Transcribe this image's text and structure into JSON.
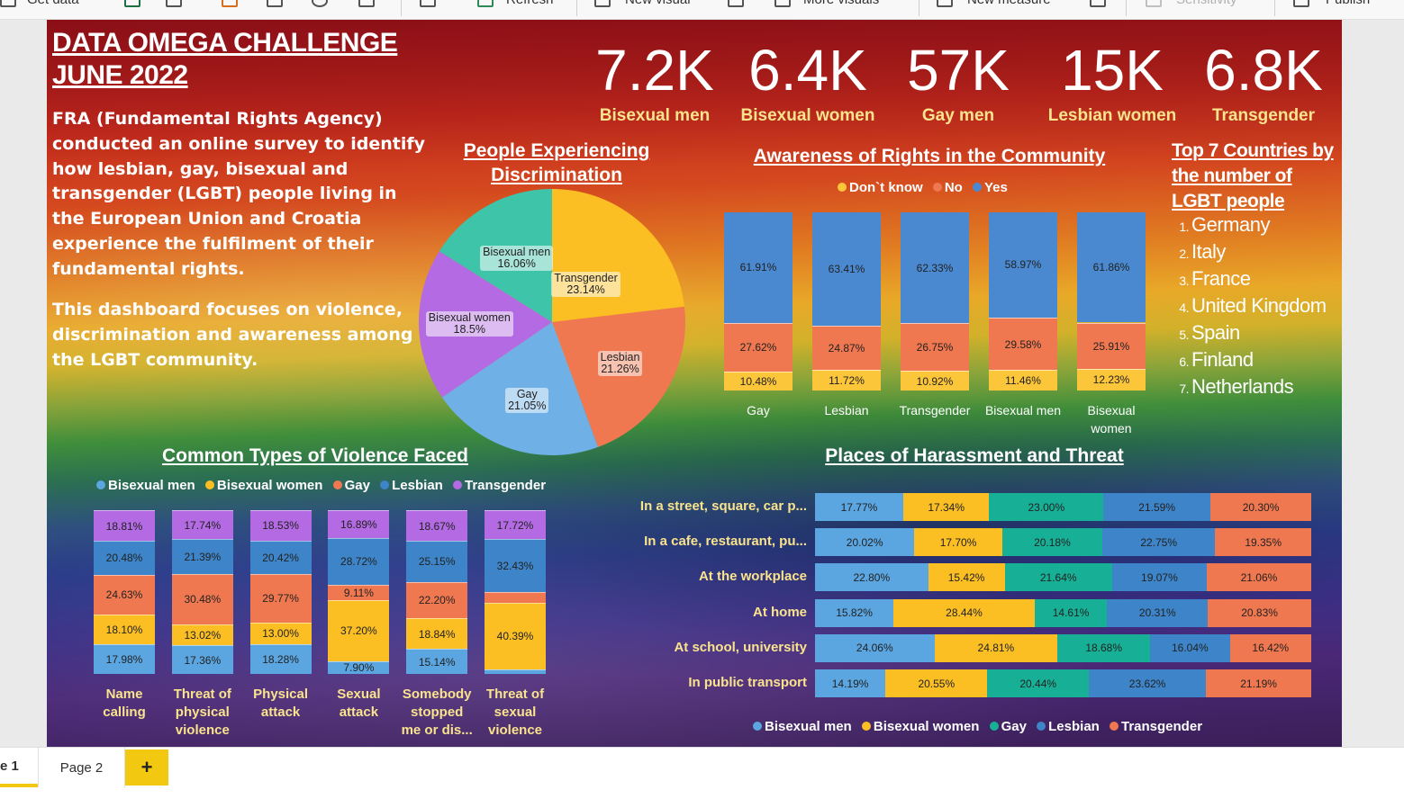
{
  "ribbon": {
    "items": [
      "Get data",
      "Refresh",
      "New visual",
      "More visuals",
      "New measure",
      "Sensitivity",
      "Publish"
    ]
  },
  "report": {
    "title_line1": "DATA OMEGA CHALLENGE",
    "title_line2": "JUNE 2022",
    "intro": "FRA (Fundamental Rights Agency) conducted an online survey to identify how lesbian, gay, bisexual and transgender (LGBT) people living in the European Union and Croatia experience the fulfilment of their fundamental rights.",
    "focus": "This dashboard focuses on violence, discrimination and awareness among the LGBT community."
  },
  "kpis": [
    {
      "value": "7.2K",
      "label": "Bisexual men"
    },
    {
      "value": "6.4K",
      "label": "Bisexual women"
    },
    {
      "value": "57K",
      "label": "Gay men"
    },
    {
      "value": "15K",
      "label": "Lesbian women"
    },
    {
      "value": "6.8K",
      "label": "Transgender"
    }
  ],
  "colors": {
    "bisexual_men": "#5ba6e0",
    "bisexual_women": "#fbbf24",
    "gay": "#f07850",
    "lesbian": "#3d85c8",
    "transgender": "#b36ae2",
    "gay_teal": "#17b096",
    "pie_teal": "#3ec4a8",
    "pie_gay": "#6fb0e6",
    "awareness_yes": "#4a89cf",
    "awareness_no": "#f07850",
    "awareness_dontknow": "#fcc63a"
  },
  "pie": {
    "title": "People Experiencing Discrimination",
    "chart_data": {
      "type": "pie",
      "slices": [
        {
          "name": "Transgender",
          "value": 23.14,
          "label": "23.14%"
        },
        {
          "name": "Lesbian",
          "value": 21.26,
          "label": "21.26%"
        },
        {
          "name": "Gay",
          "value": 21.05,
          "label": "21.05%"
        },
        {
          "name": "Bisexual women",
          "value": 18.5,
          "label": "18.5%"
        },
        {
          "name": "Bisexual men",
          "value": 16.06,
          "label": "16.06%"
        }
      ]
    }
  },
  "awareness": {
    "title": "Awareness of Rights in the Community",
    "legend": [
      "Don`t know",
      "No",
      "Yes"
    ],
    "chart_data": {
      "type": "bar",
      "stacked": true,
      "categories": [
        "Gay",
        "Lesbian",
        "Transgender",
        "Bisexual men",
        "Bisexual women"
      ],
      "series": [
        {
          "name": "Don`t know",
          "values": [
            10.48,
            11.72,
            10.92,
            11.46,
            12.23
          ]
        },
        {
          "name": "No",
          "values": [
            27.62,
            24.87,
            26.75,
            29.58,
            25.91
          ]
        },
        {
          "name": "Yes",
          "values": [
            61.91,
            63.41,
            62.33,
            58.97,
            61.86
          ]
        }
      ]
    }
  },
  "countries": {
    "title": "Top 7 Countries by the number of LGBT people",
    "items": [
      "Germany",
      "Italy",
      "France",
      "United Kingdom",
      "Spain",
      "Finland",
      "Netherlands"
    ]
  },
  "violence": {
    "title": "Common Types of Violence Faced",
    "legend": [
      "Bisexual men",
      "Bisexual women",
      "Gay",
      "Lesbian",
      "Transgender"
    ],
    "chart_data": {
      "type": "bar",
      "stacked": true,
      "categories": [
        "Name calling",
        "Threat of physical violence",
        "Physical attack",
        "Sexual attack",
        "Somebody stopped me or dis...",
        "Threat of sexual violence"
      ],
      "series": [
        {
          "name": "Bisexual men",
          "values": [
            17.98,
            17.36,
            18.28,
            7.9,
            15.14,
            3.03
          ]
        },
        {
          "name": "Bisexual women",
          "values": [
            18.1,
            13.02,
            13.0,
            37.2,
            18.84,
            40.39
          ]
        },
        {
          "name": "Gay",
          "values": [
            24.63,
            30.48,
            29.77,
            9.11,
            22.2,
            6.44
          ]
        },
        {
          "name": "Lesbian",
          "values": [
            20.48,
            21.39,
            20.42,
            28.72,
            25.15,
            32.43
          ]
        },
        {
          "name": "Transgender",
          "values": [
            18.81,
            17.74,
            18.53,
            16.89,
            18.67,
            17.72
          ]
        }
      ]
    }
  },
  "harassment": {
    "title": "Places of Harassment and Threat",
    "legend": [
      "Bisexual men",
      "Bisexual women",
      "Gay",
      "Lesbian",
      "Transgender"
    ],
    "chart_data": {
      "type": "bar",
      "orientation": "horizontal",
      "stacked": true,
      "categories": [
        "In a street, square, car p...",
        "In a cafe, restaurant, pu...",
        "At the workplace",
        "At home",
        "At school, university",
        "In public transport"
      ],
      "series": [
        {
          "name": "Bisexual men",
          "values": [
            17.77,
            20.02,
            22.8,
            15.82,
            24.06,
            14.19
          ]
        },
        {
          "name": "Bisexual women",
          "values": [
            17.34,
            17.7,
            15.42,
            28.44,
            24.81,
            20.55
          ]
        },
        {
          "name": "Gay",
          "values": [
            23.0,
            20.18,
            21.64,
            14.61,
            18.68,
            20.44
          ]
        },
        {
          "name": "Lesbian",
          "values": [
            21.59,
            22.75,
            19.07,
            20.31,
            16.04,
            23.62
          ]
        },
        {
          "name": "Transgender",
          "values": [
            20.3,
            19.35,
            21.06,
            20.83,
            16.42,
            21.19
          ]
        }
      ]
    }
  },
  "tabs": {
    "page1": "e 1",
    "page2": "Page 2",
    "add": "+"
  }
}
